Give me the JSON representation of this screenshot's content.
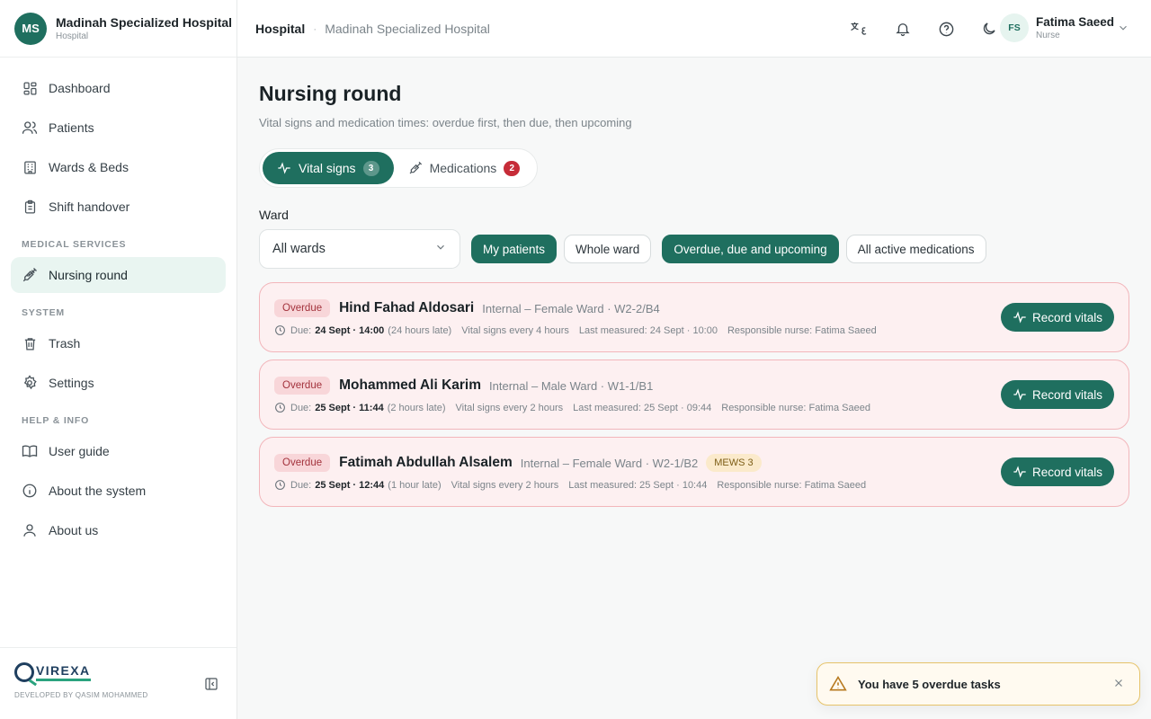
{
  "brand": {
    "initials": "MS",
    "name": "Madinah Specialized Hospital",
    "sub": "Hospital"
  },
  "sidebar": {
    "items": [
      {
        "label": "Dashboard",
        "icon": "dashboard-icon"
      },
      {
        "label": "Patients",
        "icon": "users-icon"
      },
      {
        "label": "Wards & Beds",
        "icon": "building-icon"
      },
      {
        "label": "Shift handover",
        "icon": "clipboard-icon"
      }
    ],
    "section_medical": "MEDICAL SERVICES",
    "nursing": {
      "label": "Nursing round",
      "icon": "syringe-icon"
    },
    "section_system": "SYSTEM",
    "system_items": [
      {
        "label": "Trash",
        "icon": "trash-icon"
      },
      {
        "label": "Settings",
        "icon": "gear-icon"
      }
    ],
    "section_help": "HELP & INFO",
    "help_items": [
      {
        "label": "User guide",
        "icon": "book-icon"
      },
      {
        "label": "About the system",
        "icon": "info-icon"
      },
      {
        "label": "About us",
        "icon": "user-icon"
      }
    ],
    "footer_logo": "VIREXA",
    "footer_dev": "DEVELOPED BY QASIM MOHAMMED"
  },
  "topbar": {
    "crumb_root": "Hospital",
    "crumb_current": "Madinah Specialized Hospital",
    "user_initials": "FS",
    "user_name": "Fatima Saeed",
    "user_role": "Nurse"
  },
  "page": {
    "title": "Nursing round",
    "subtitle": "Vital signs and medication times: overdue first, then due, then upcoming"
  },
  "tabs": [
    {
      "label": "Vital signs",
      "count": "3",
      "active": true
    },
    {
      "label": "Medications",
      "count": "2",
      "active": false
    }
  ],
  "filters": {
    "ward_label": "Ward",
    "ward_value": "All wards",
    "chips": [
      "My patients",
      "Whole ward",
      "Overdue, due and upcoming",
      "All active medications"
    ]
  },
  "tasks": [
    {
      "status": "Overdue",
      "name": "Hind Fahad Aldosari",
      "location": "Internal – Female Ward · W2-2/B4",
      "mews": "",
      "due_label": "Due:",
      "due": "24 Sept · 14:00",
      "late": "(24 hours late)",
      "frequency": "Vital signs every 4 hours",
      "last": "Last measured: 24 Sept · 10:00",
      "nurse": "Responsible nurse: Fatima Saeed",
      "action": "Record vitals"
    },
    {
      "status": "Overdue",
      "name": "Mohammed Ali Karim",
      "location": "Internal – Male Ward · W1-1/B1",
      "mews": "",
      "due_label": "Due:",
      "due": "25 Sept · 11:44",
      "late": "(2 hours late)",
      "frequency": "Vital signs every 2 hours",
      "last": "Last measured: 25 Sept · 09:44",
      "nurse": "Responsible nurse: Fatima Saeed",
      "action": "Record vitals"
    },
    {
      "status": "Overdue",
      "name": "Fatimah Abdullah Alsalem",
      "location": "Internal – Female Ward · W2-1/B2",
      "mews": "MEWS 3",
      "due_label": "Due:",
      "due": "25 Sept · 12:44",
      "late": "(1 hour late)",
      "frequency": "Vital signs every 2 hours",
      "last": "Last measured: 25 Sept · 10:44",
      "nurse": "Responsible nurse: Fatima Saeed",
      "action": "Record vitals"
    }
  ],
  "toast": {
    "text": "You have 5 overdue tasks"
  },
  "colors": {
    "primary": "#1f6f5f",
    "overdue_bg": "#fdf0f1",
    "overdue_border": "#f2b6bb",
    "danger": "#c62c38",
    "warning": "#e6c36a"
  }
}
